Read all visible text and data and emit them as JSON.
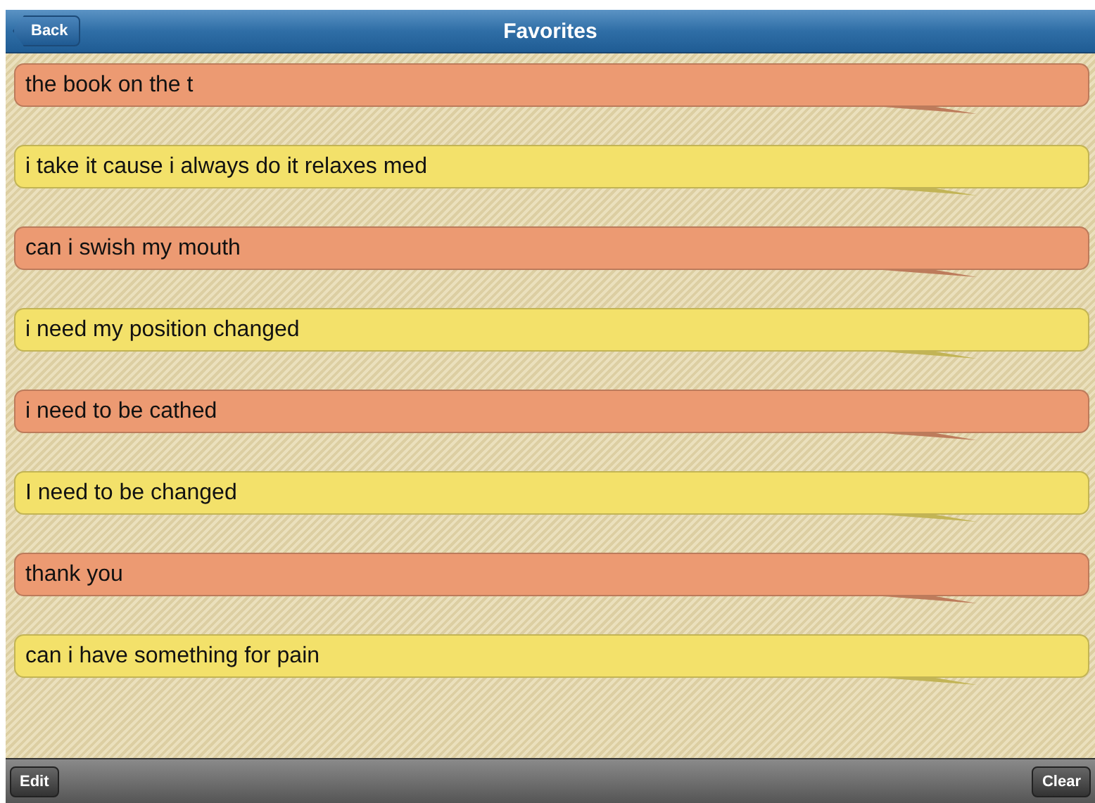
{
  "nav_bar": {
    "back_button": "Back",
    "title": "Favorites"
  },
  "favorites": [
    {
      "text": "the book on the t",
      "color": "#ec9a72"
    },
    {
      "text": "i take it cause i always do it relaxes med",
      "color": "#f3e16a"
    },
    {
      "text": "can i swish my mouth",
      "color": "#ec9a72"
    },
    {
      "text": "i need my position changed",
      "color": "#f3e16a"
    },
    {
      "text": "i need to be cathed",
      "color": "#ec9a72"
    },
    {
      "text": "I need to be changed",
      "color": "#f3e16a"
    },
    {
      "text": "thank you",
      "color": "#ec9a72"
    },
    {
      "text": "can i have something for pain",
      "color": "#f3e16a"
    }
  ],
  "toolbar": {
    "edit_button": "Edit",
    "clear_button": "Clear"
  }
}
